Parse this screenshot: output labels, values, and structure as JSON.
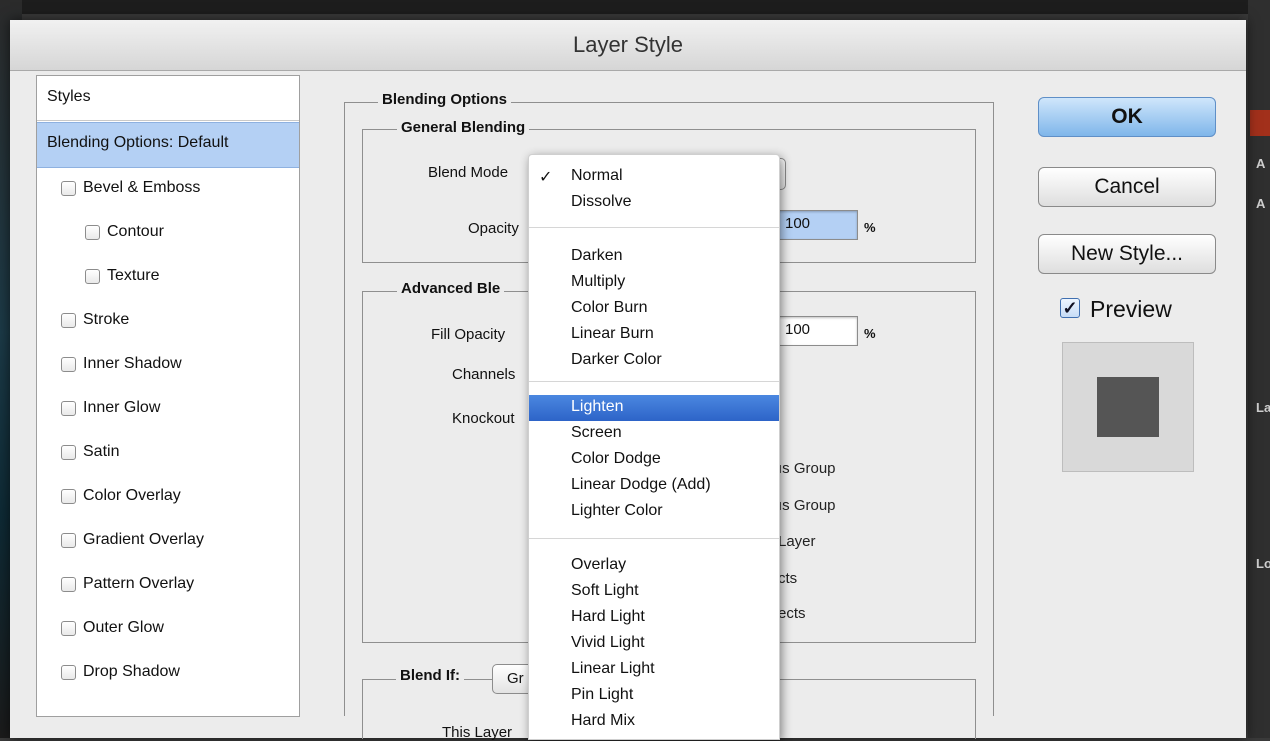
{
  "dialog": {
    "title": "Layer Style"
  },
  "styles": {
    "header": "Styles",
    "items": [
      {
        "label": "Blending Options: Default",
        "selected": true,
        "checkbox": false,
        "indent": 0
      },
      {
        "label": "Bevel & Emboss",
        "checkbox": true,
        "indent": 0
      },
      {
        "label": "Contour",
        "checkbox": true,
        "indent": 1
      },
      {
        "label": "Texture",
        "checkbox": true,
        "indent": 1
      },
      {
        "label": "Stroke",
        "checkbox": true,
        "indent": 0
      },
      {
        "label": "Inner Shadow",
        "checkbox": true,
        "indent": 0
      },
      {
        "label": "Inner Glow",
        "checkbox": true,
        "indent": 0
      },
      {
        "label": "Satin",
        "checkbox": true,
        "indent": 0
      },
      {
        "label": "Color Overlay",
        "checkbox": true,
        "indent": 0
      },
      {
        "label": "Gradient Overlay",
        "checkbox": true,
        "indent": 0
      },
      {
        "label": "Pattern Overlay",
        "checkbox": true,
        "indent": 0
      },
      {
        "label": "Outer Glow",
        "checkbox": true,
        "indent": 0
      },
      {
        "label": "Drop Shadow",
        "checkbox": true,
        "indent": 0
      }
    ]
  },
  "blending": {
    "group_title": "Blending Options",
    "general": {
      "title": "General Blending",
      "blend_mode_label": "Blend Mode",
      "opacity_label": "Opacity",
      "opacity_value": "100",
      "percent": "%"
    },
    "advanced": {
      "title": "Advanced Ble",
      "fill_opacity_label": "Fill Opacity",
      "fill_opacity_value": "100",
      "percent": "%",
      "channels_label": "Channels",
      "knockout_label": "Knockout",
      "partial": [
        "ıs Group",
        "ıs Group",
        "Layer",
        "cts",
        "ects"
      ]
    },
    "blend_if": {
      "label": "Blend If:",
      "value": "Gr",
      "this_layer": "This Layer"
    }
  },
  "blend_menu": {
    "checked": "Normal",
    "highlighted": "Lighten",
    "groups": [
      [
        "Normal",
        "Dissolve"
      ],
      [
        "Darken",
        "Multiply",
        "Color Burn",
        "Linear Burn",
        "Darker Color"
      ],
      [
        "Lighten",
        "Screen",
        "Color Dodge",
        "Linear Dodge (Add)",
        "Lighter Color"
      ],
      [
        "Overlay",
        "Soft Light",
        "Hard Light",
        "Vivid Light",
        "Linear Light",
        "Pin Light",
        "Hard Mix"
      ]
    ]
  },
  "buttons": {
    "ok": "OK",
    "cancel": "Cancel",
    "new_style": "New Style..."
  },
  "preview": {
    "label": "Preview",
    "checked": true,
    "swatch_color": "#555555"
  },
  "background_app": {
    "side_letters": [
      "A",
      "A",
      "La",
      "Lo"
    ]
  }
}
